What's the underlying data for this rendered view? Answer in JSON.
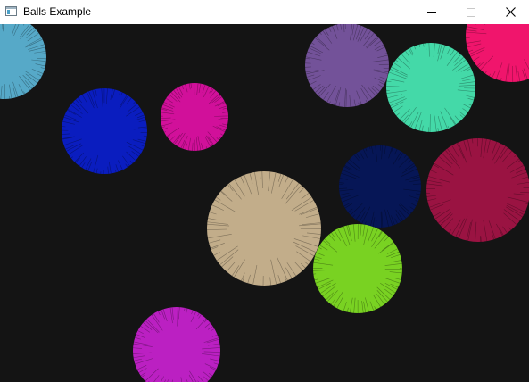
{
  "window": {
    "title": "Balls Example",
    "icon": "app-window-icon",
    "controls": [
      "minimize-icon",
      "maximize-icon",
      "close-icon"
    ]
  },
  "canvas": {
    "background": "#141414",
    "ball_colors": [
      "#56a9c8",
      "#0a1dbf",
      "#d1109a",
      "#735299",
      "#44d9a8",
      "#f0156c",
      "#c2ad8a",
      "#061656",
      "#9a1342",
      "#79d222",
      "#bb20c2"
    ]
  }
}
